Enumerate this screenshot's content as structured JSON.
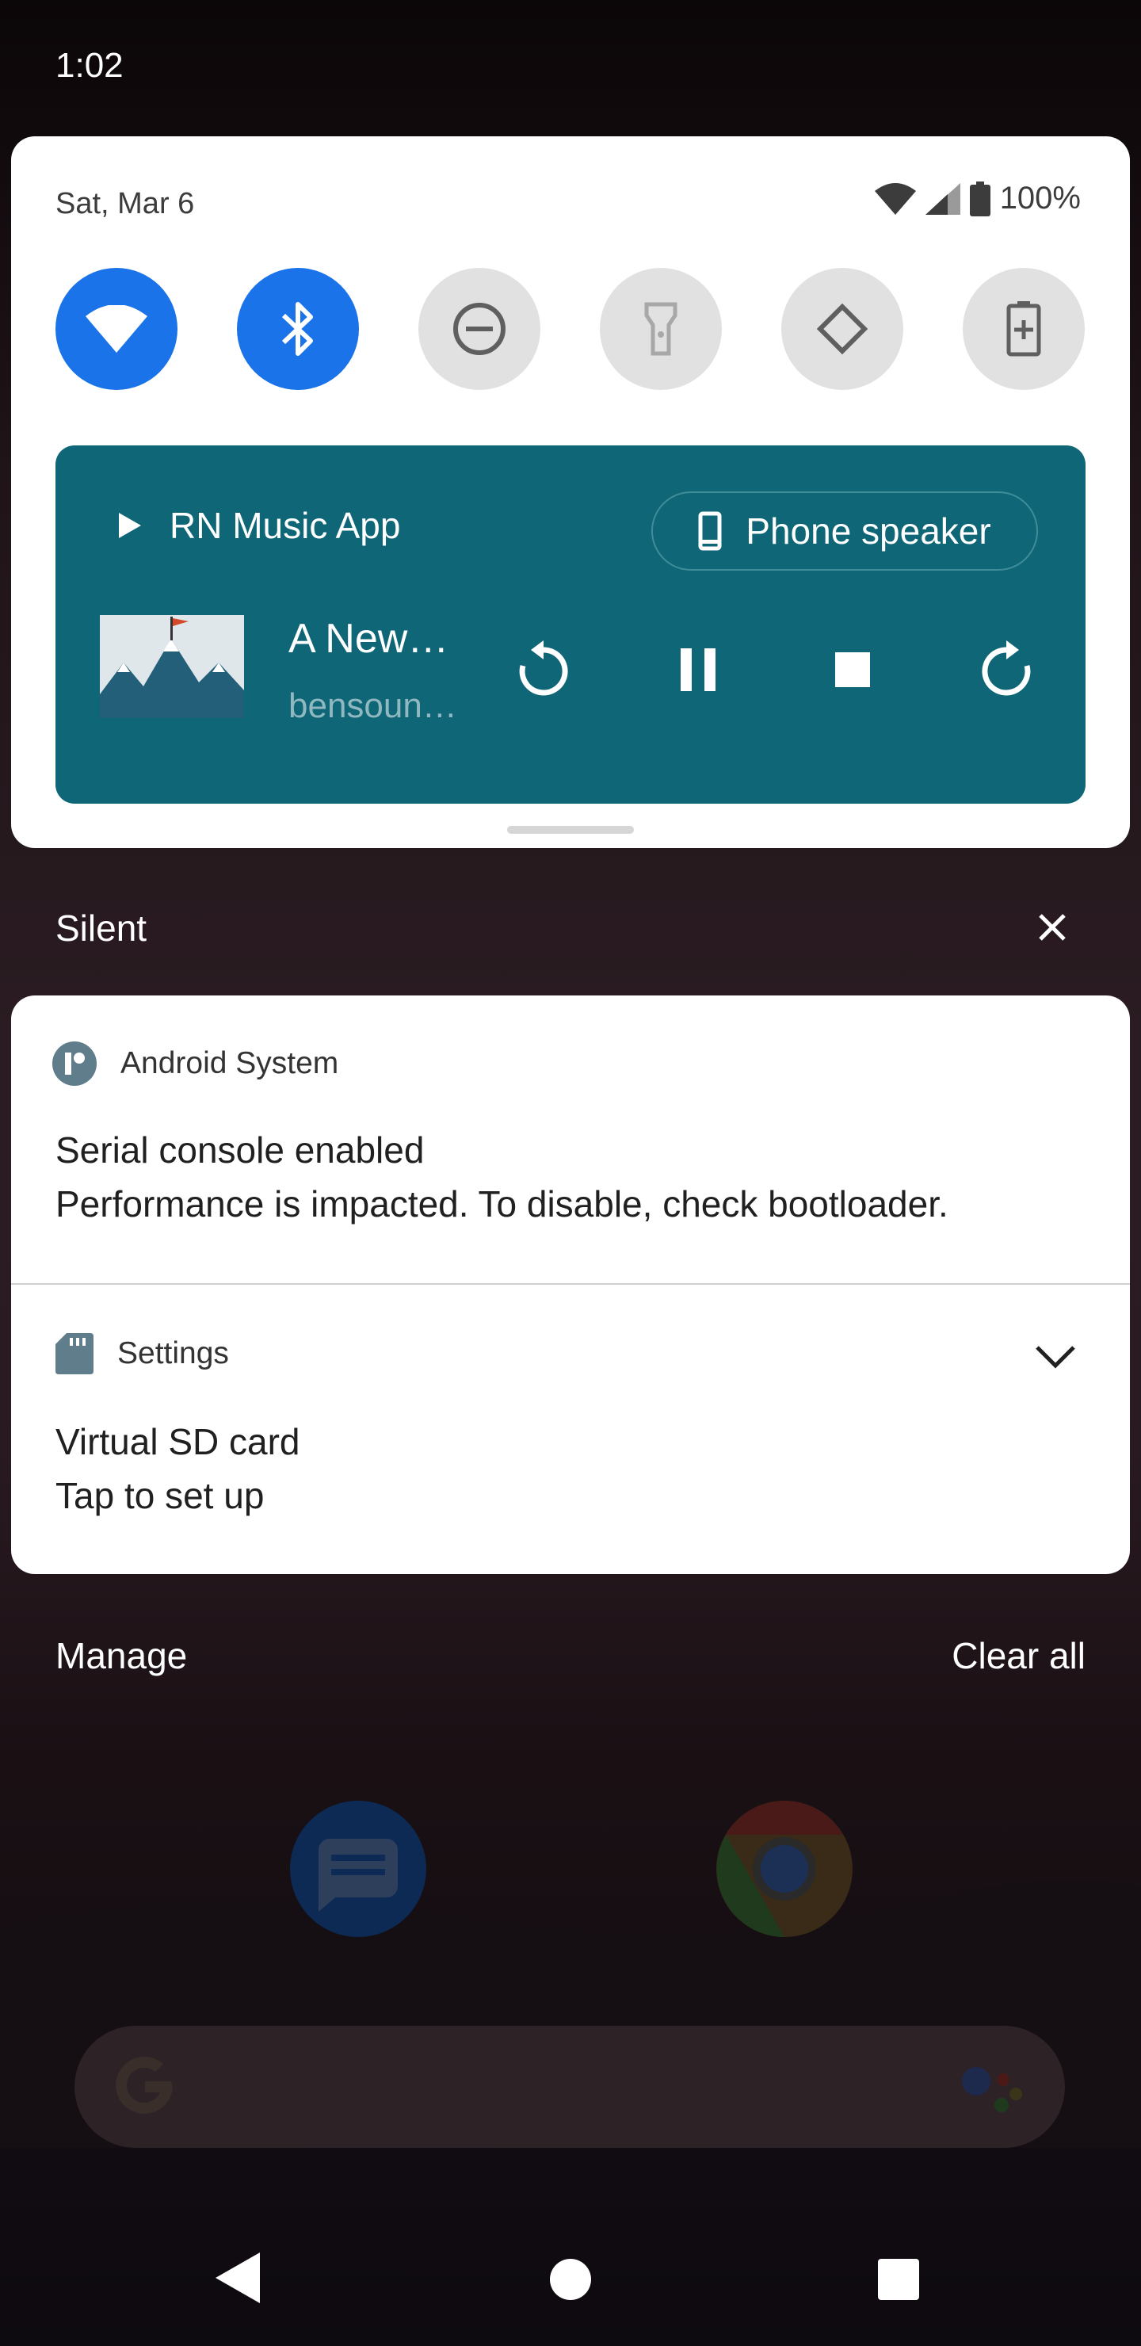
{
  "status_bar": {
    "time": "1:02"
  },
  "quick_settings": {
    "date": "Sat, Mar 6",
    "battery_percent": "100%",
    "tiles": [
      {
        "name": "wifi",
        "active": true
      },
      {
        "name": "bluetooth",
        "active": true
      },
      {
        "name": "do-not-disturb",
        "active": false
      },
      {
        "name": "flashlight",
        "active": false
      },
      {
        "name": "auto-rotate",
        "active": false
      },
      {
        "name": "battery-saver",
        "active": false
      }
    ]
  },
  "media": {
    "app_name": "RN Music App",
    "output_label": "Phone speaker",
    "track_title": "A New…",
    "track_artist": "bensoun…"
  },
  "notifications": {
    "section_title": "Silent",
    "items": [
      {
        "app": "Android System",
        "title": "Serial console enabled",
        "text": "Performance is impacted. To disable, check bootloader."
      },
      {
        "app": "Settings",
        "title": "Virtual SD card",
        "text": "Tap to set up"
      }
    ],
    "manage_label": "Manage",
    "clear_all_label": "Clear all"
  },
  "colors": {
    "tile_active": "#1a73e8",
    "tile_inactive": "#e1e1e1",
    "media_background": "#0e6676"
  }
}
